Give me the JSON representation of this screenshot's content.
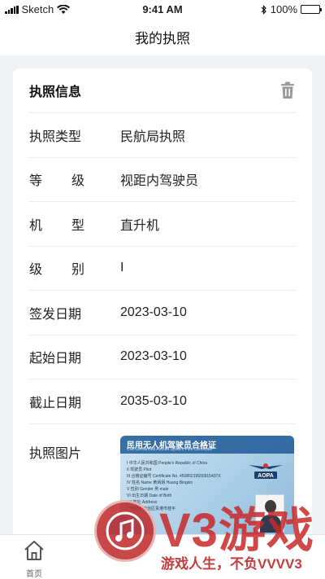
{
  "status_bar": {
    "carrier": "Sketch",
    "time": "9:41 AM",
    "battery": "100%"
  },
  "nav": {
    "title": "我的执照"
  },
  "card": {
    "title": "执照信息",
    "fields": [
      {
        "label": "执照类型",
        "value": "民航局执照"
      },
      {
        "label_chars": [
          "等",
          "级"
        ],
        "value": "视距内驾驶员"
      },
      {
        "label_chars": [
          "机",
          "型"
        ],
        "value": "直升机"
      },
      {
        "label_chars": [
          "级",
          "别"
        ],
        "value": "I"
      },
      {
        "label": "签发日期",
        "value": "2023-03-10"
      },
      {
        "label": "起始日期",
        "value": "2023-03-10"
      },
      {
        "label": "截止日期",
        "value": "2035-03-10"
      }
    ],
    "photo_label": "执照图片",
    "certificate": {
      "title": "民用无人机驾驶员合格证",
      "subtitle": "Civil Unmanned Aircraft System Pilot Certificate",
      "lines": [
        "I 中华人民共和国 People's Republic of China",
        "II 驾驶员 Pilot",
        "III 合格证编号 Certificate No. 45080219930915437X",
        "IV 姓名 Name 黄炳炳 Huang Bingxin",
        "V 性别 Gender 男 male",
        "VI 出生日期 Date of Birth",
        "VII 地址 Address",
        "广西壮族自治区贵港市桂平"
      ],
      "logo_text": "AOPA"
    }
  },
  "tab_bar": {
    "home_label": "首页"
  },
  "watermark": {
    "brand": "V3游戏",
    "slogan": "游戏人生，不负VVVV3"
  },
  "colors": {
    "accent": "#7bb1e8",
    "watermark": "#c82828",
    "cert_band": "#1f5a96"
  }
}
